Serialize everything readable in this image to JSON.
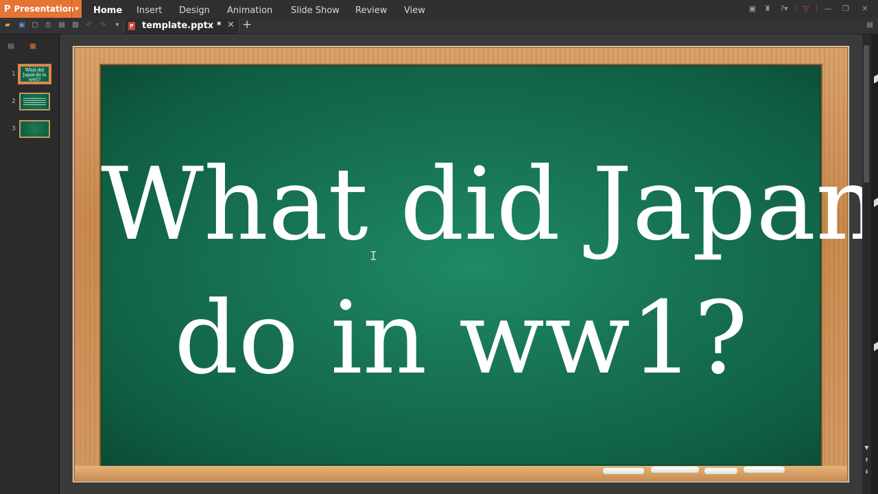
{
  "app": {
    "name": "Presentation",
    "logo": "P"
  },
  "menu": {
    "items": [
      "Home",
      "Insert",
      "Design",
      "Animation",
      "Slide Show",
      "Review",
      "View"
    ],
    "active": "Home"
  },
  "window_controls": {
    "skin_icon": "skin-icon",
    "theme_icon": "shirt-icon",
    "help_label": "?",
    "minimize_icon": "minimize-icon",
    "restore_icon": "restore-icon",
    "close_icon": "close-icon"
  },
  "toolbar": {
    "icons": [
      "open-icon",
      "save-icon",
      "new-icon",
      "print-icon",
      "print-preview-icon",
      "export-icon",
      "undo-icon",
      "redo-icon",
      "dropdown-icon"
    ]
  },
  "tab": {
    "title": "template.pptx *",
    "close_symbol": "✕",
    "add_symbol": "+"
  },
  "slides_panel": {
    "slides": [
      {
        "number": "1",
        "thumb_text": "What did Japan do in ww1?"
      },
      {
        "number": "2",
        "thumb_text": ""
      },
      {
        "number": "3",
        "thumb_text": ""
      }
    ],
    "selected": "1"
  },
  "slide": {
    "title_line1": "What did Japan",
    "title_line2": "do in ww1?"
  },
  "colors": {
    "accent": "#e67433",
    "board_green": "#187655",
    "frame_wood": "#c9894f"
  }
}
